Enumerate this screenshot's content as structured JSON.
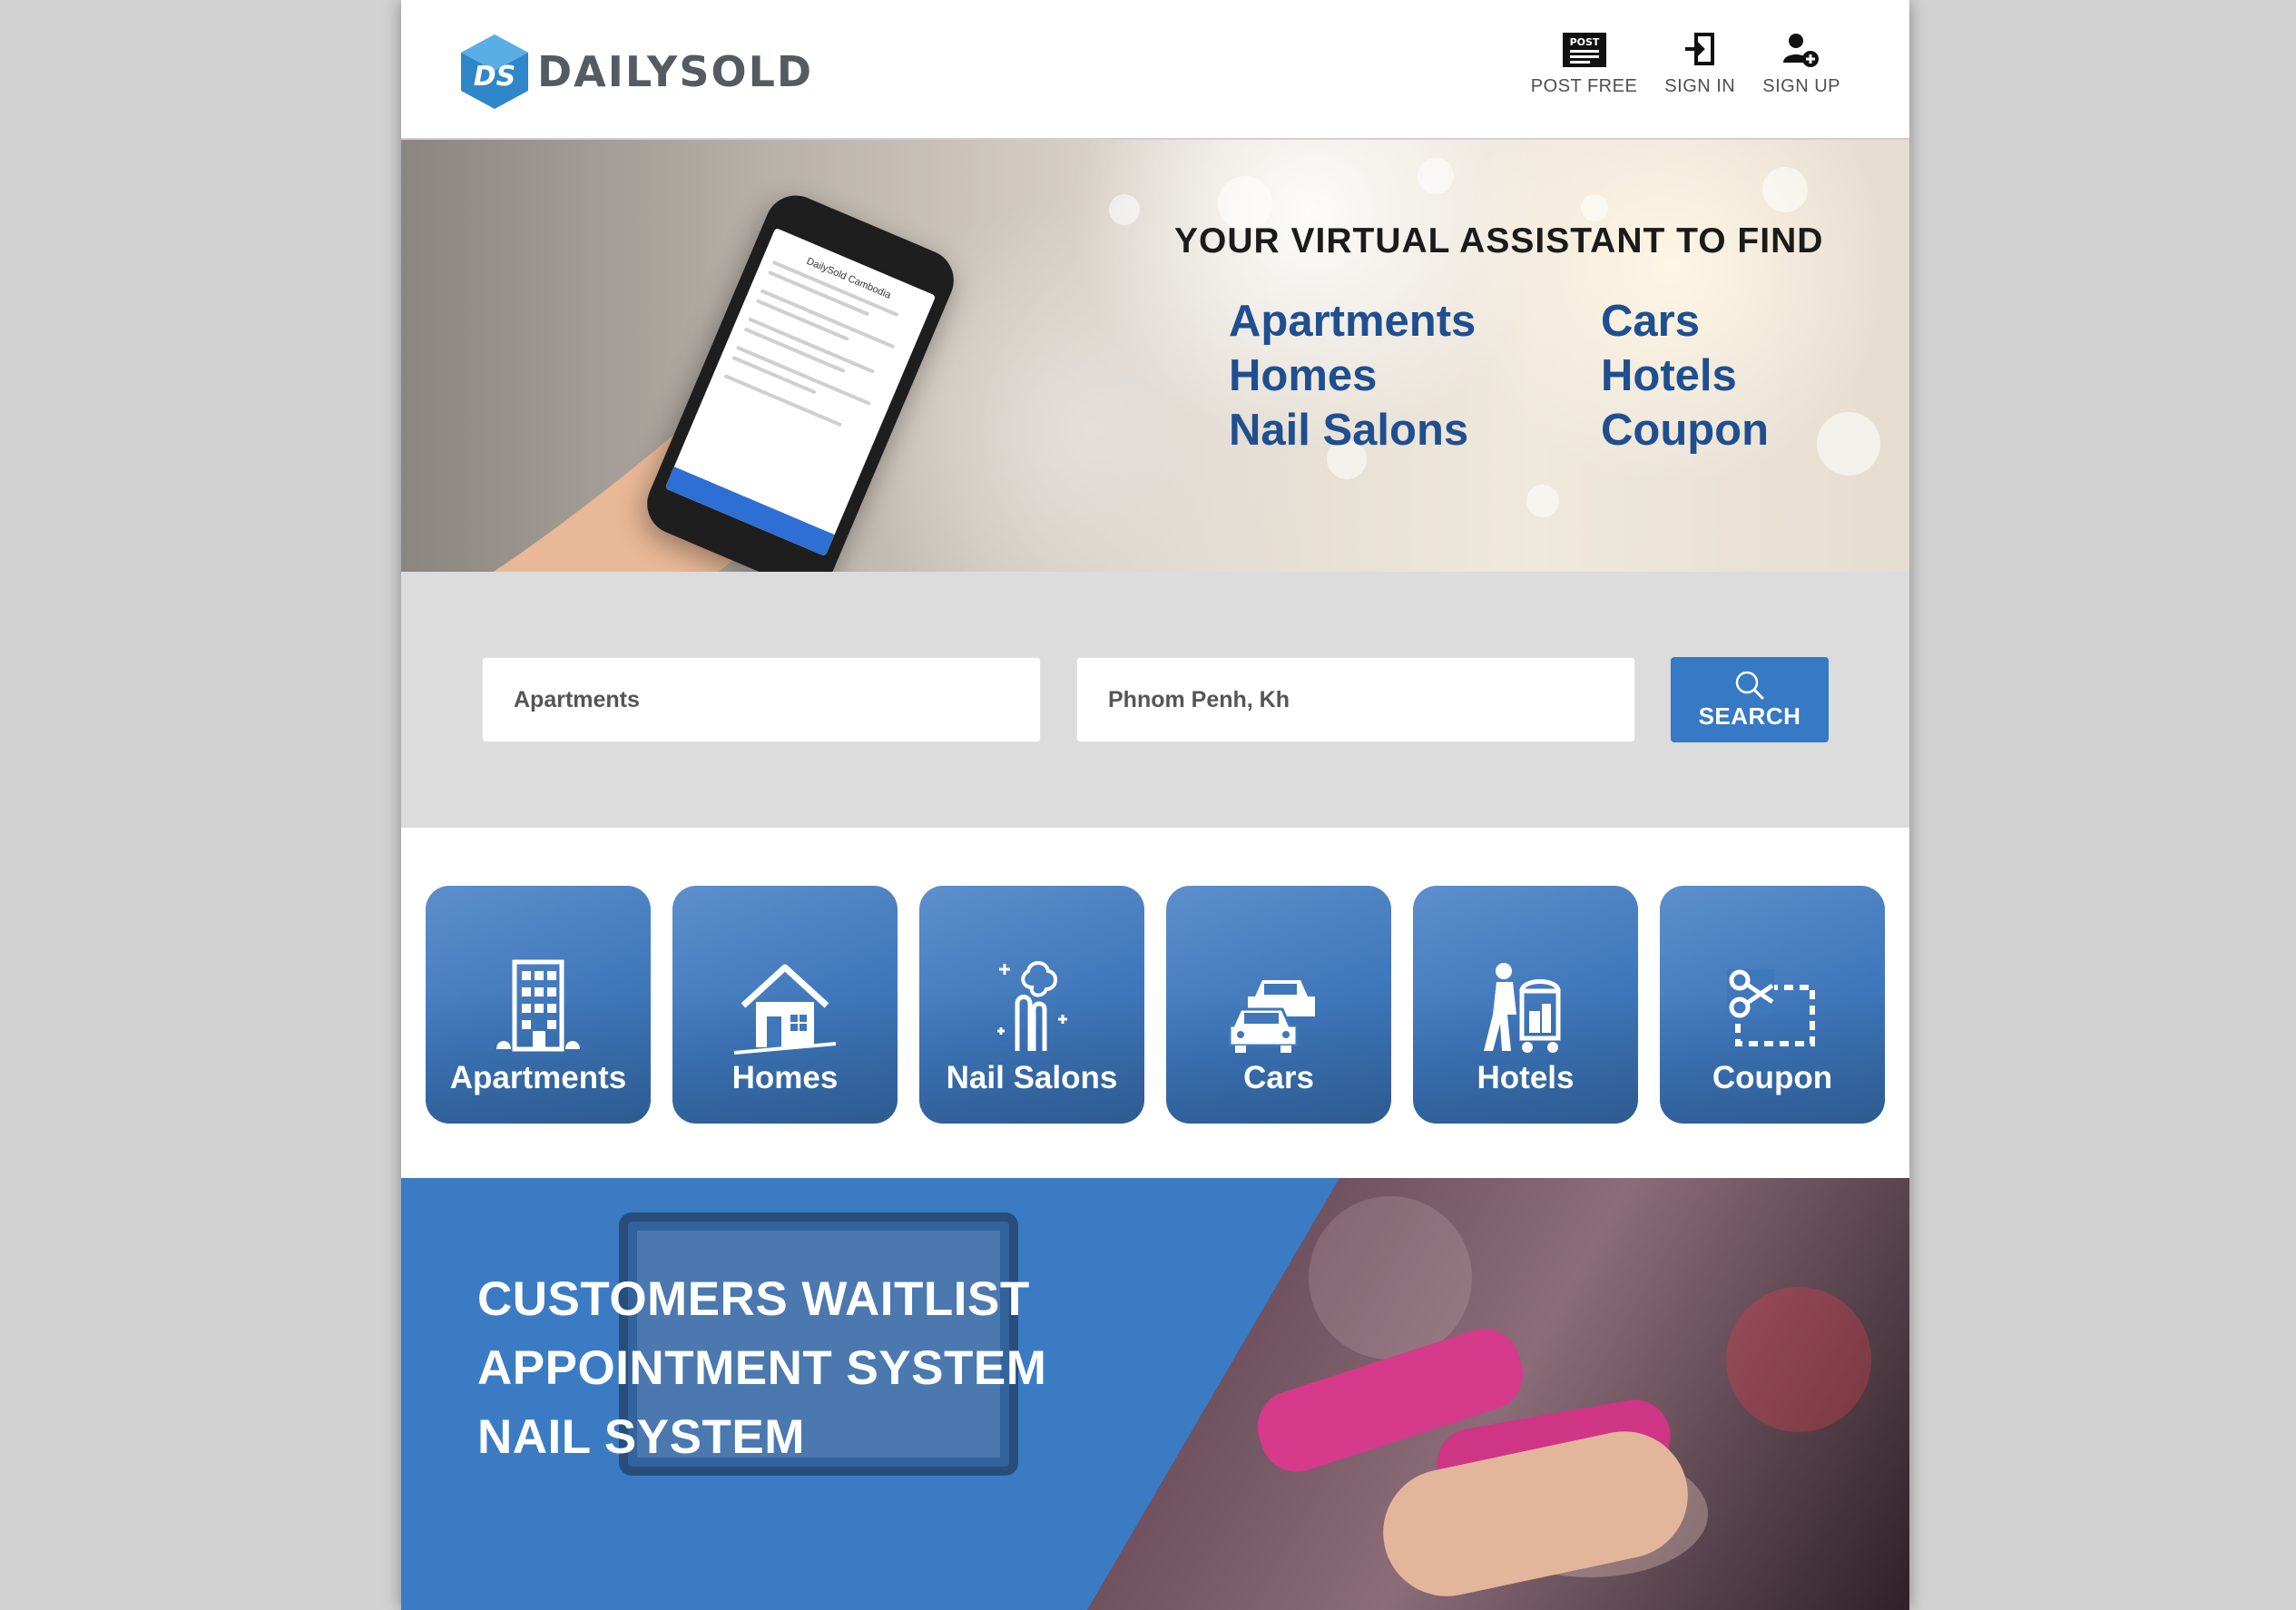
{
  "brand": {
    "name": "DAILYSOLD",
    "monogram": "DS"
  },
  "nav": [
    {
      "icon": "post-icon",
      "icon_text": "POST",
      "label": "POST FREE"
    },
    {
      "icon": "sign-in-icon",
      "label": "SIGN IN"
    },
    {
      "icon": "sign-up-icon",
      "label": "SIGN UP"
    }
  ],
  "hero": {
    "title": "YOUR VIRTUAL ASSISTANT TO FIND",
    "items": [
      "Apartments",
      "Cars",
      "Homes",
      "Hotels",
      "Nail Salons",
      "Coupon"
    ]
  },
  "search": {
    "what_value": "Apartments",
    "where_value": "Phnom Penh, Kh",
    "button_label": "SEARCH"
  },
  "categories": [
    {
      "label": "Apartments",
      "icon": "apartment-building-icon"
    },
    {
      "label": "Homes",
      "icon": "house-icon"
    },
    {
      "label": "Nail Salons",
      "icon": "nail-salon-icon"
    },
    {
      "label": "Cars",
      "icon": "cars-icon"
    },
    {
      "label": "Hotels",
      "icon": "hotel-bellhop-icon"
    },
    {
      "label": "Coupon",
      "icon": "coupon-scissors-icon"
    }
  ],
  "promo": {
    "lines": [
      "CUSTOMERS WAITLIST",
      "APPOINTMENT SYSTEM",
      "NAIL SYSTEM"
    ]
  },
  "colors": {
    "accent": "#3679c4",
    "hero_text": "#1f4f8f",
    "page_bg": "#d2d2d2"
  }
}
